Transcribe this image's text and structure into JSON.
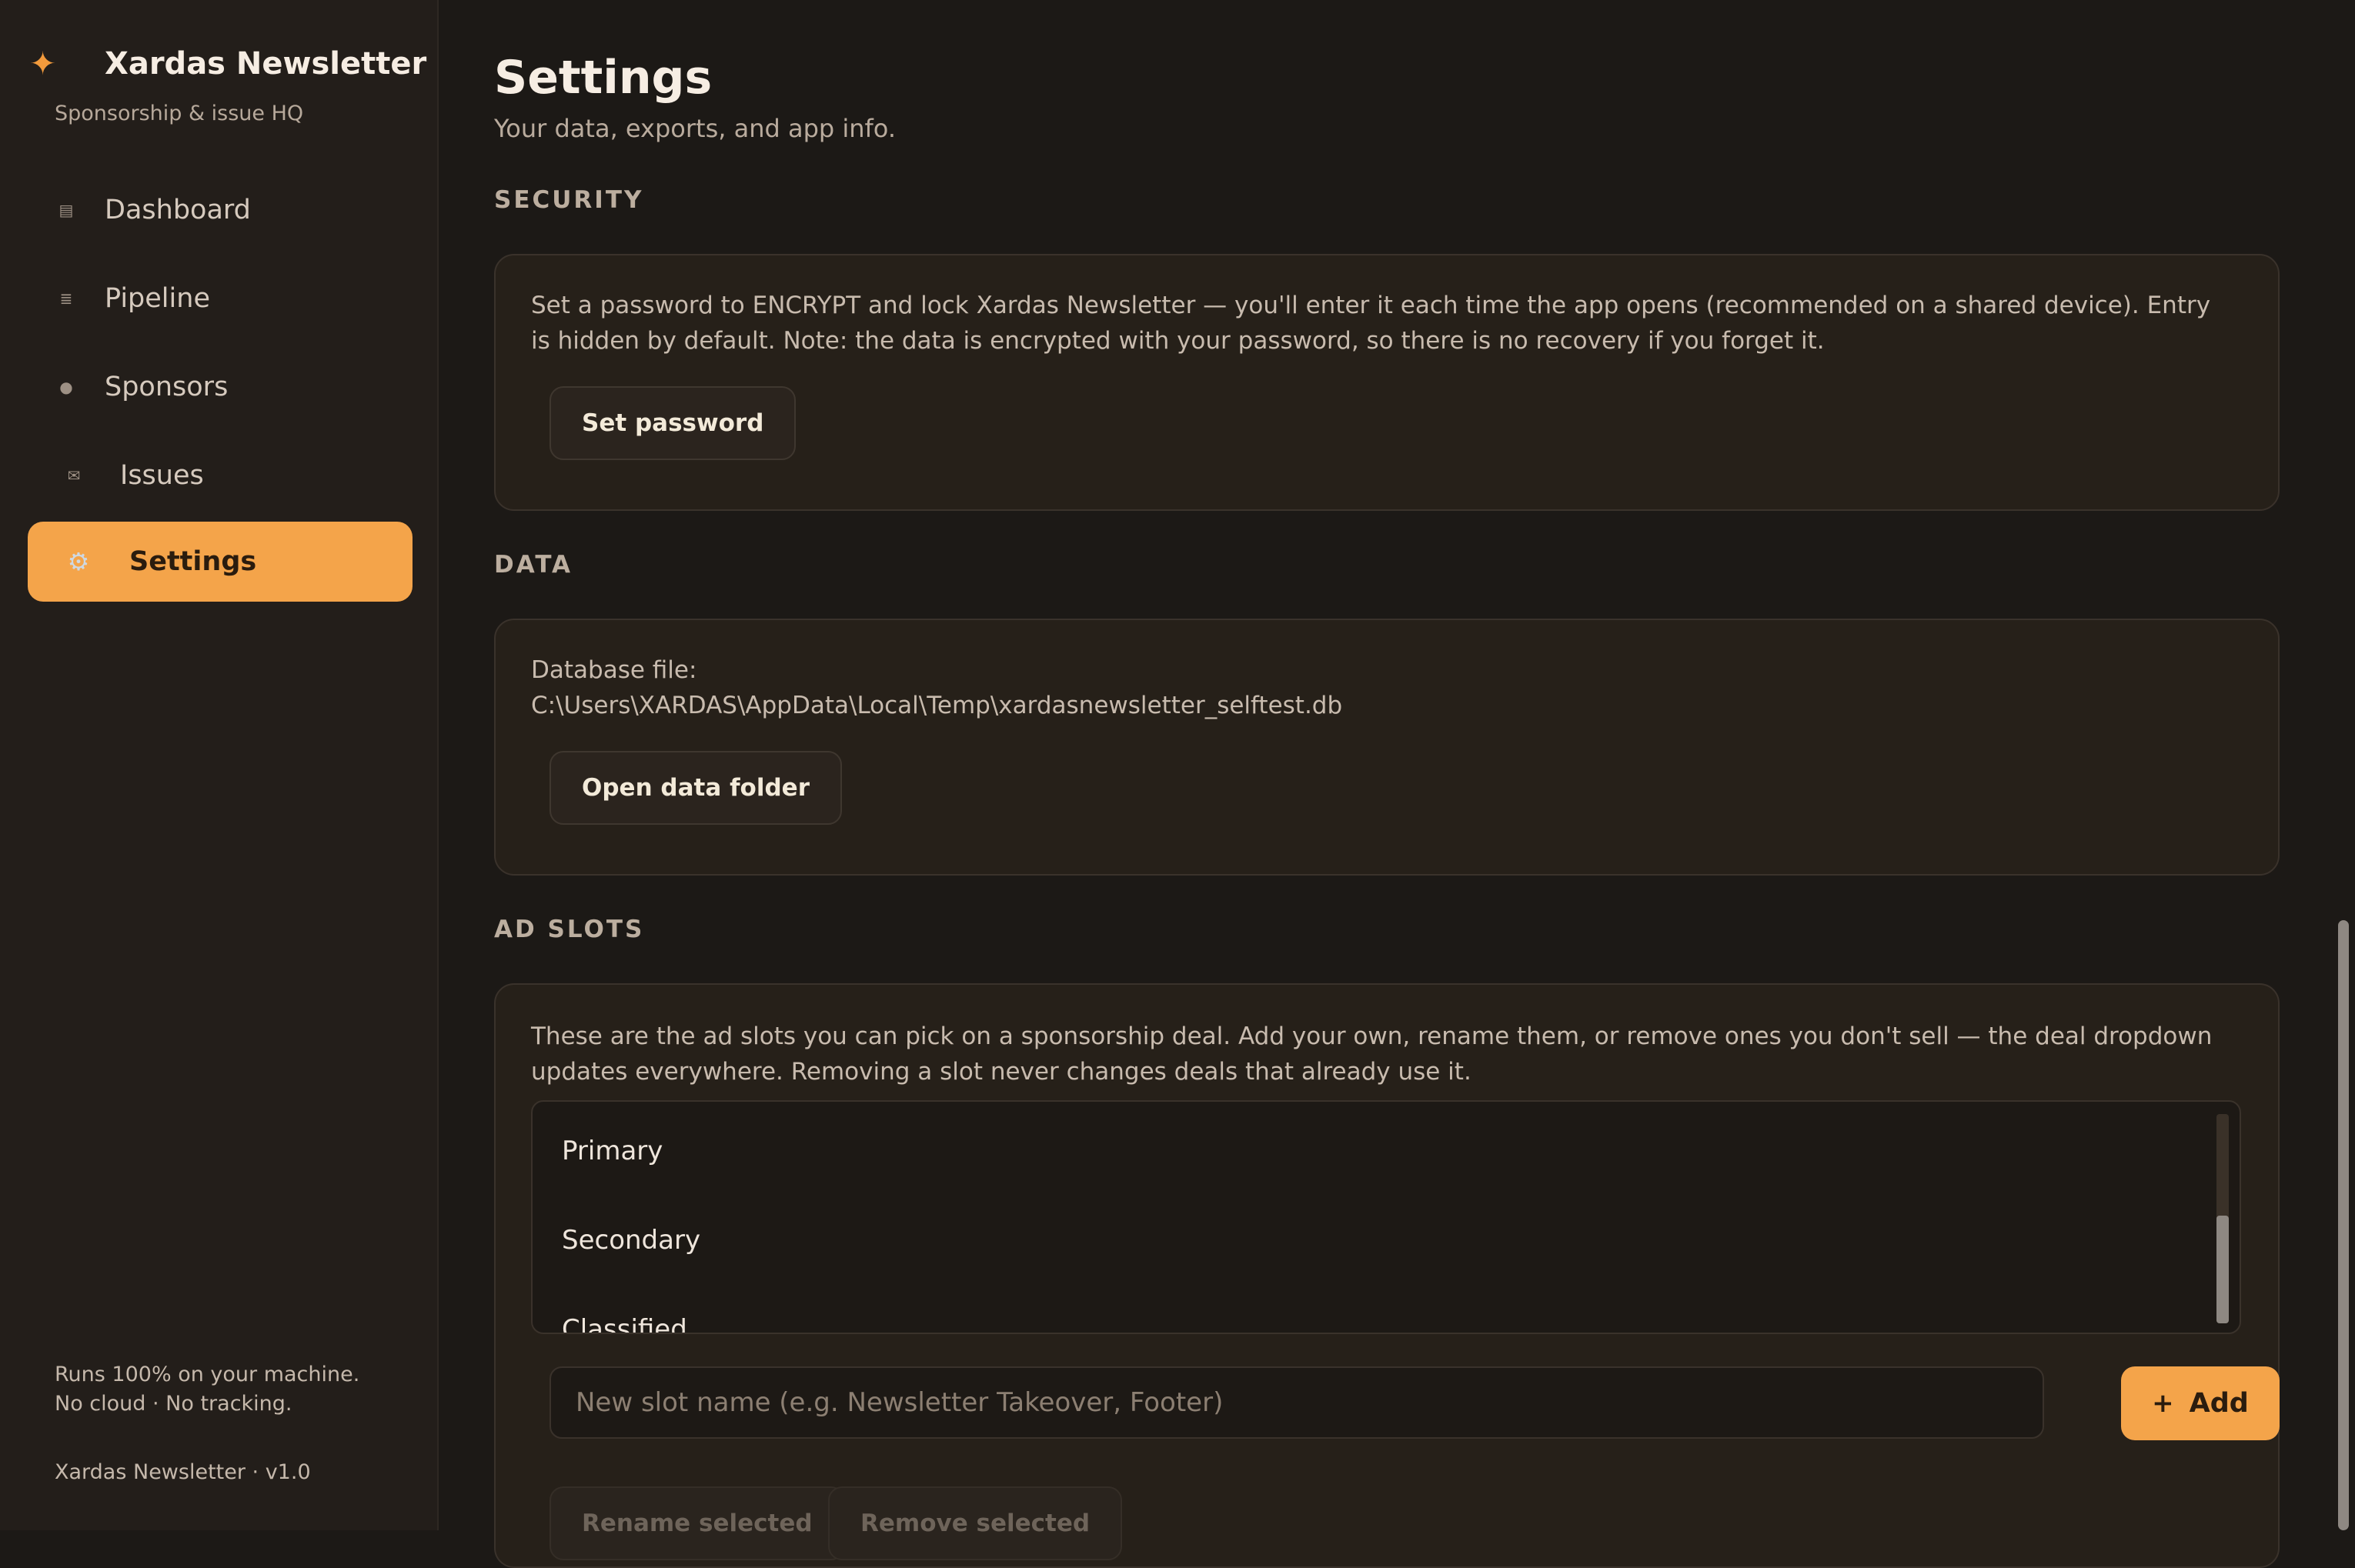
{
  "app": {
    "name": "Xardas Newsletter",
    "tagline": "Sponsorship & issue HQ",
    "accent_color": "#f4a44a"
  },
  "sidebar": {
    "items": [
      {
        "label": "Dashboard",
        "icon": "dashboard-icon",
        "active": false
      },
      {
        "label": "Pipeline",
        "icon": "pipeline-icon",
        "active": false
      },
      {
        "label": "Sponsors",
        "icon": "sponsors-icon",
        "active": false
      },
      {
        "label": "Issues",
        "icon": "mail-icon",
        "active": false
      },
      {
        "label": "Settings",
        "icon": "gear-icon",
        "active": true
      }
    ],
    "footer_line1": "Runs 100% on your machine.",
    "footer_line2": "No cloud · No tracking.",
    "version": "Xardas Newsletter · v1.0"
  },
  "page": {
    "title": "Settings",
    "subtitle": "Your data, exports, and app info."
  },
  "security": {
    "heading": "SECURITY",
    "description": "Set a password to ENCRYPT and lock Xardas Newsletter — you'll enter it each time the app opens (recommended on a shared device). Entry is hidden by default. Note: the data is encrypted with your password, so there is no recovery if you forget it.",
    "button": "Set password"
  },
  "data": {
    "heading": "DATA",
    "db_label": "Database file:",
    "db_path": "C:\\Users\\XARDAS\\AppData\\Local\\Temp\\xardasnewsletter_selftest.db",
    "button": "Open data folder"
  },
  "ad_slots": {
    "heading": "AD SLOTS",
    "description": "These are the ad slots you can pick on a sponsorship deal. Add your own, rename them, or remove ones you don't sell — the deal dropdown updates everywhere. Removing a slot never changes deals that already use it.",
    "slots": [
      "Primary",
      "Secondary",
      "Classified"
    ],
    "input_placeholder": "New slot name (e.g. Newsletter Takeover, Footer)",
    "input_value": "",
    "add_button": "Add",
    "rename_button": "Rename selected",
    "remove_button": "Remove selected"
  }
}
